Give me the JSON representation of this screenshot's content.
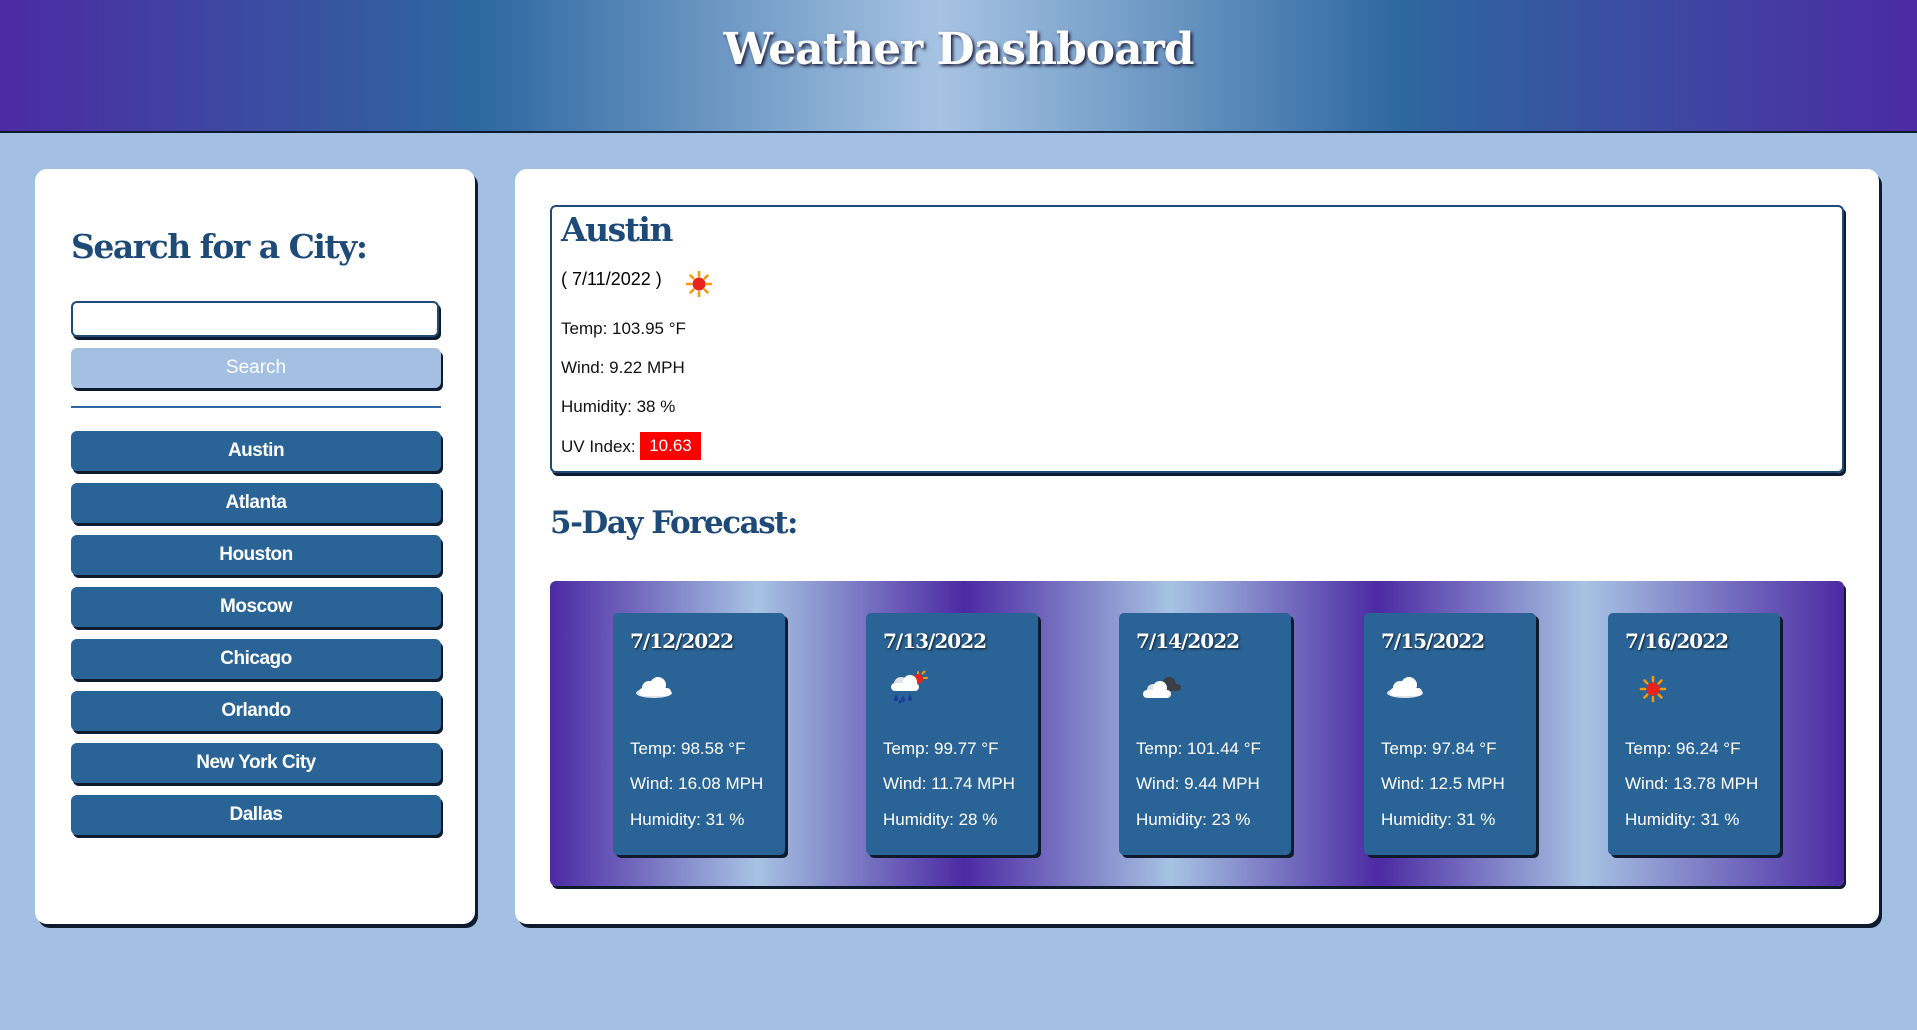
{
  "header": {
    "title": "Weather Dashboard"
  },
  "search": {
    "heading": "Search for a City:",
    "input_value": "",
    "button_label": "Search",
    "history": [
      "Austin",
      "Atlanta",
      "Houston",
      "Moscow",
      "Chicago",
      "Orlando",
      "New York City",
      "Dallas"
    ]
  },
  "current": {
    "city": "Austin",
    "date": "( 7/11/2022 )",
    "icon": "sun-icon",
    "temp": "Temp: 103.95 °F",
    "wind": "Wind: 9.22 MPH",
    "humidity": "Humidity: 38 %",
    "uv_label": "UV Index:",
    "uv_value": "10.63",
    "uv_color": "#ff0000"
  },
  "forecast": {
    "heading": "5-Day Forecast:",
    "days": [
      {
        "date": "7/12/2022",
        "icon": "cloud-icon",
        "temp": "Temp: 98.58 °F",
        "wind": "Wind: 16.08 MPH",
        "humidity": "Humidity: 31 %"
      },
      {
        "date": "7/13/2022",
        "icon": "rain-sun-icon",
        "temp": "Temp: 99.77 °F",
        "wind": "Wind: 11.74 MPH",
        "humidity": "Humidity: 28 %"
      },
      {
        "date": "7/14/2022",
        "icon": "broken-clouds-icon",
        "temp": "Temp: 101.44 °F",
        "wind": "Wind: 9.44 MPH",
        "humidity": "Humidity: 23 %"
      },
      {
        "date": "7/15/2022",
        "icon": "cloud-icon",
        "temp": "Temp: 97.84 °F",
        "wind": "Wind: 12.5 MPH",
        "humidity": "Humidity: 31 %"
      },
      {
        "date": "7/16/2022",
        "icon": "sun-icon",
        "temp": "Temp: 96.24 °F",
        "wind": "Wind: 13.78 MPH",
        "humidity": "Humidity: 31 %"
      }
    ]
  },
  "colors": {
    "accent": "#2a6396",
    "background": "#a3c0e3",
    "heading": "#1e4a78",
    "gradient_purple": "#4c2aa3"
  }
}
